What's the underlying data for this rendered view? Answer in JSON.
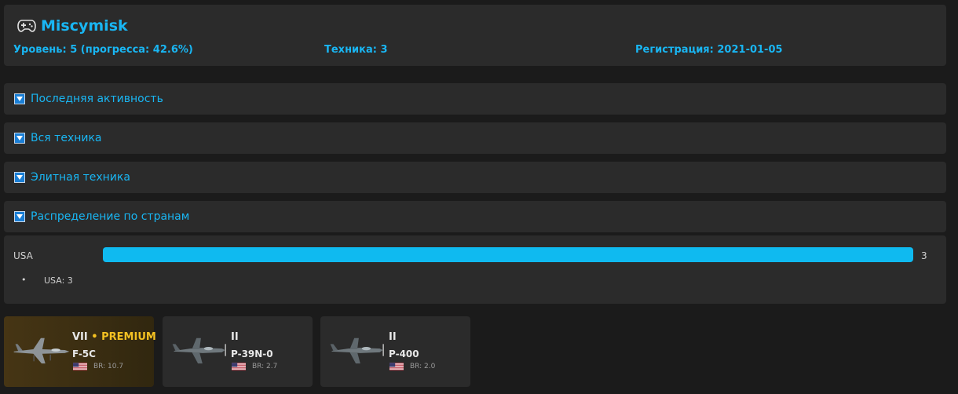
{
  "player": {
    "icon": "gamepad-icon",
    "name": "Miscymisk",
    "level_text": "Уровень: 5 (прогресса: 42.6%)",
    "vehicles_text": "Техника: 3",
    "registered_text": "Регистрация: 2021-01-05"
  },
  "sections": [
    {
      "label": "Последняя активность",
      "icon": "collapse-toggle-icon"
    },
    {
      "label": "Вся техника",
      "icon": "collapse-toggle-icon"
    },
    {
      "label": "Элитная техника",
      "icon": "collapse-toggle-icon"
    },
    {
      "label": "Распределение по странам",
      "icon": "collapse-toggle-icon"
    }
  ],
  "countries": {
    "rows": [
      {
        "name": "USA",
        "count": "3",
        "share": 1.0
      }
    ],
    "list": [
      {
        "text": "USA: 3"
      }
    ]
  },
  "vehicles": [
    {
      "tier": "VII",
      "separator": "•",
      "badge": "PREMIUM",
      "name": "F-5C",
      "br": "BR: 10.7",
      "nation_icon": "usa-flag-icon",
      "premium": true
    },
    {
      "tier": "II",
      "separator": "",
      "badge": "",
      "name": "P-39N-0",
      "br": "BR: 2.7",
      "nation_icon": "usa-flag-icon",
      "premium": false
    },
    {
      "tier": "II",
      "separator": "",
      "badge": "",
      "name": "P-400",
      "br": "BR: 2.0",
      "nation_icon": "usa-flag-icon",
      "premium": false
    }
  ],
  "colors": {
    "accent": "#19b6f3",
    "bar": "#0fbaf0",
    "premium": "#f2c022",
    "panel": "#2b2b2b",
    "background": "#1b1b1b"
  }
}
